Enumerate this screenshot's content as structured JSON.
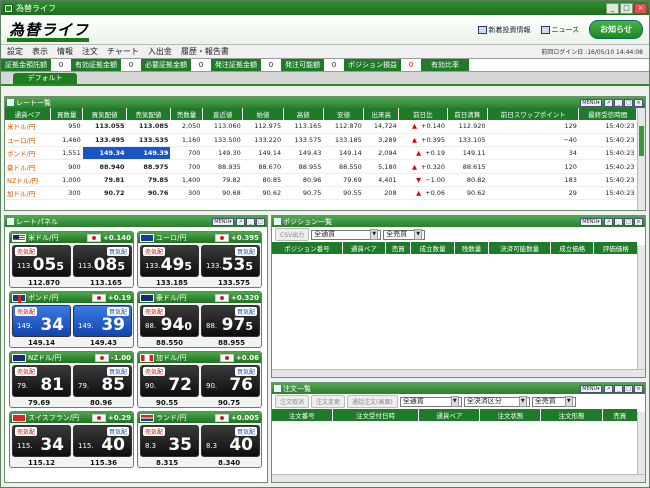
{
  "window": {
    "title": "為替ライフ"
  },
  "header": {
    "logo": "為替ライフ",
    "links": [
      "新着投資情報",
      "ニュース"
    ],
    "notice_button": "お知らせ"
  },
  "menu": {
    "items": [
      "設定",
      "表示",
      "情報",
      "注文",
      "チャート",
      "入出金",
      "履歴・報告書"
    ],
    "login_info": "前回ログイン日 :16/05/10 14:44:08"
  },
  "account": [
    {
      "label": "証拠金預託額",
      "value": "0"
    },
    {
      "label": "有効証拠金額",
      "value": "0"
    },
    {
      "label": "必要証拠金額",
      "value": "0"
    },
    {
      "label": "発注証拠金額",
      "value": "0"
    },
    {
      "label": "発注可能額",
      "value": "0"
    },
    {
      "label": "ポジション損益",
      "value": "0",
      "color": "red"
    },
    {
      "label": "有効比率",
      "value": ""
    }
  ],
  "tabs": {
    "default": "デフォルト"
  },
  "rate_list": {
    "title": "レート一覧",
    "headers": [
      "通貨ペア",
      "買数量",
      "買気配値",
      "売気配値",
      "売数量",
      "直近値",
      "始値",
      "高値",
      "安値",
      "出来高",
      "前日比",
      "前日清算",
      "前日スワップポイント",
      "最終受信時間"
    ],
    "rows": [
      [
        "米ドル/円",
        "950",
        "113.055",
        "113.085",
        "2,050",
        "113.060",
        "112.975",
        "113.165",
        "112.870",
        "14,724",
        "▲",
        "+0.140",
        "112.920",
        "129",
        "15:40:23"
      ],
      [
        "ユーロ/円",
        "1,460",
        "133.495",
        "133.535",
        "1,160",
        "133.500",
        "133.220",
        "133.575",
        "133.185",
        "3,289",
        "▲",
        "+0.395",
        "133.105",
        "−40",
        "15:40:23"
      ],
      [
        "ポンド/円",
        "1,551",
        "149.34",
        "149.39",
        "700",
        "149.30",
        "149.14",
        "149.43",
        "149.14",
        "2,094",
        "▲",
        "+0.19",
        "149.11",
        "34",
        "15:40:23"
      ],
      [
        "豪ドル/円",
        "900",
        "88.940",
        "88.975",
        "700",
        "88.935",
        "88.670",
        "88.955",
        "88.550",
        "5,180",
        "▲",
        "+0.320",
        "88.615",
        "120",
        "15:40:23"
      ],
      [
        "NZドル/円",
        "1,000",
        "79.81",
        "79.85",
        "1,400",
        "79.82",
        "80.85",
        "80.96",
        "79.69",
        "4,401",
        "▼",
        "−1.00",
        "80.82",
        "183",
        "15:40:23"
      ],
      [
        "加ドル/円",
        "300",
        "90.72",
        "90.76",
        "300",
        "90.68",
        "90.62",
        "90.75",
        "90.55",
        "208",
        "▲",
        "+0.06",
        "90.62",
        "29",
        "15:40:23"
      ]
    ]
  },
  "rate_panel": {
    "title": "レートパネル",
    "sell_label": "売気配",
    "buy_label": "買気配",
    "cards": [
      {
        "pair": "米ドル/円",
        "change": "+0.140",
        "sell_prefix": "113.",
        "sell_big": "05",
        "sell_tail": "5",
        "buy_prefix": "113.",
        "buy_big": "08",
        "buy_tail": "5",
        "low": "112.870",
        "high": "113.165",
        "flag": "us",
        "highlight": false
      },
      {
        "pair": "ユーロ/円",
        "change": "+0.395",
        "sell_prefix": "133.",
        "sell_big": "49",
        "sell_tail": "5",
        "buy_prefix": "133.",
        "buy_big": "53",
        "buy_tail": "5",
        "low": "133.185",
        "high": "133.575",
        "flag": "eu",
        "highlight": false
      },
      {
        "pair": "ポンド/円",
        "change": "+0.19",
        "sell_prefix": "149.",
        "sell_big": "34",
        "sell_tail": "",
        "buy_prefix": "149.",
        "buy_big": "39",
        "buy_tail": "",
        "low": "149.14",
        "high": "149.43",
        "flag": "gb",
        "highlight": true
      },
      {
        "pair": "豪ドル/円",
        "change": "+0.320",
        "sell_prefix": "88.",
        "sell_big": "94",
        "sell_tail": "0",
        "buy_prefix": "88.",
        "buy_big": "97",
        "buy_tail": "5",
        "low": "88.550",
        "high": "88.955",
        "flag": "au",
        "highlight": false
      },
      {
        "pair": "NZドル/円",
        "change": "-1.00",
        "sell_prefix": "79.",
        "sell_big": "81",
        "sell_tail": "",
        "buy_prefix": "79.",
        "buy_big": "85",
        "buy_tail": "",
        "low": "79.69",
        "high": "80.96",
        "flag": "nz",
        "highlight": false
      },
      {
        "pair": "加ドル/円",
        "change": "+0.06",
        "sell_prefix": "90.",
        "sell_big": "72",
        "sell_tail": "",
        "buy_prefix": "90.",
        "buy_big": "76",
        "buy_tail": "",
        "low": "90.55",
        "high": "90.75",
        "flag": "ca",
        "highlight": false
      },
      {
        "pair": "スイスフラン/円",
        "change": "+0.29",
        "sell_prefix": "115.",
        "sell_big": "34",
        "sell_tail": "",
        "buy_prefix": "115.",
        "buy_big": "40",
        "buy_tail": "",
        "low": "115.12",
        "high": "115.36",
        "flag": "ch",
        "highlight": false
      },
      {
        "pair": "ランド/円",
        "change": "+0.005",
        "sell_prefix": "8.3",
        "sell_big": "35",
        "sell_tail": "",
        "buy_prefix": "8.3",
        "buy_big": "40",
        "buy_tail": "",
        "low": "8.315",
        "high": "8.340",
        "flag": "za",
        "highlight": false
      }
    ]
  },
  "position_list": {
    "title": "ポジション一覧",
    "csv_btn": "CSV出力",
    "currency_filter": "全通貨",
    "side_filter": "全売買",
    "headers": [
      "ポジション番号",
      "通貨ペア",
      "売買",
      "成立数量",
      "残数量",
      "決済可能数量",
      "成立価格",
      "評価価格"
    ]
  },
  "order_list": {
    "title": "注文一覧",
    "buttons": [
      "注文取消",
      "注文変更",
      "通話注文(画面)"
    ],
    "currency_filter": "全通貨",
    "settle_filter": "全決済区分",
    "side_filter": "全売買",
    "headers": [
      "注文番号",
      "注文受付日時",
      "通貨ペア",
      "注文状態",
      "注文形態",
      "売買"
    ]
  }
}
